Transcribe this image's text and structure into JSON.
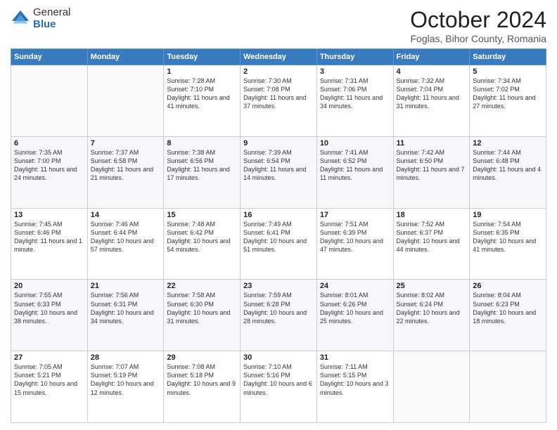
{
  "logo": {
    "general": "General",
    "blue": "Blue"
  },
  "header": {
    "month": "October 2024",
    "location": "Foglas, Bihor County, Romania"
  },
  "weekdays": [
    "Sunday",
    "Monday",
    "Tuesday",
    "Wednesday",
    "Thursday",
    "Friday",
    "Saturday"
  ],
  "weeks": [
    [
      {
        "day": "",
        "sunrise": "",
        "sunset": "",
        "daylight": ""
      },
      {
        "day": "",
        "sunrise": "",
        "sunset": "",
        "daylight": ""
      },
      {
        "day": "1",
        "sunrise": "Sunrise: 7:28 AM",
        "sunset": "Sunset: 7:10 PM",
        "daylight": "Daylight: 11 hours and 41 minutes."
      },
      {
        "day": "2",
        "sunrise": "Sunrise: 7:30 AM",
        "sunset": "Sunset: 7:08 PM",
        "daylight": "Daylight: 11 hours and 37 minutes."
      },
      {
        "day": "3",
        "sunrise": "Sunrise: 7:31 AM",
        "sunset": "Sunset: 7:06 PM",
        "daylight": "Daylight: 11 hours and 34 minutes."
      },
      {
        "day": "4",
        "sunrise": "Sunrise: 7:32 AM",
        "sunset": "Sunset: 7:04 PM",
        "daylight": "Daylight: 11 hours and 31 minutes."
      },
      {
        "day": "5",
        "sunrise": "Sunrise: 7:34 AM",
        "sunset": "Sunset: 7:02 PM",
        "daylight": "Daylight: 11 hours and 27 minutes."
      }
    ],
    [
      {
        "day": "6",
        "sunrise": "Sunrise: 7:35 AM",
        "sunset": "Sunset: 7:00 PM",
        "daylight": "Daylight: 11 hours and 24 minutes."
      },
      {
        "day": "7",
        "sunrise": "Sunrise: 7:37 AM",
        "sunset": "Sunset: 6:58 PM",
        "daylight": "Daylight: 11 hours and 21 minutes."
      },
      {
        "day": "8",
        "sunrise": "Sunrise: 7:38 AM",
        "sunset": "Sunset: 6:56 PM",
        "daylight": "Daylight: 11 hours and 17 minutes."
      },
      {
        "day": "9",
        "sunrise": "Sunrise: 7:39 AM",
        "sunset": "Sunset: 6:54 PM",
        "daylight": "Daylight: 11 hours and 14 minutes."
      },
      {
        "day": "10",
        "sunrise": "Sunrise: 7:41 AM",
        "sunset": "Sunset: 6:52 PM",
        "daylight": "Daylight: 11 hours and 11 minutes."
      },
      {
        "day": "11",
        "sunrise": "Sunrise: 7:42 AM",
        "sunset": "Sunset: 6:50 PM",
        "daylight": "Daylight: 11 hours and 7 minutes."
      },
      {
        "day": "12",
        "sunrise": "Sunrise: 7:44 AM",
        "sunset": "Sunset: 6:48 PM",
        "daylight": "Daylight: 11 hours and 4 minutes."
      }
    ],
    [
      {
        "day": "13",
        "sunrise": "Sunrise: 7:45 AM",
        "sunset": "Sunset: 6:46 PM",
        "daylight": "Daylight: 11 hours and 1 minute."
      },
      {
        "day": "14",
        "sunrise": "Sunrise: 7:46 AM",
        "sunset": "Sunset: 6:44 PM",
        "daylight": "Daylight: 10 hours and 57 minutes."
      },
      {
        "day": "15",
        "sunrise": "Sunrise: 7:48 AM",
        "sunset": "Sunset: 6:42 PM",
        "daylight": "Daylight: 10 hours and 54 minutes."
      },
      {
        "day": "16",
        "sunrise": "Sunrise: 7:49 AM",
        "sunset": "Sunset: 6:41 PM",
        "daylight": "Daylight: 10 hours and 51 minutes."
      },
      {
        "day": "17",
        "sunrise": "Sunrise: 7:51 AM",
        "sunset": "Sunset: 6:39 PM",
        "daylight": "Daylight: 10 hours and 47 minutes."
      },
      {
        "day": "18",
        "sunrise": "Sunrise: 7:52 AM",
        "sunset": "Sunset: 6:37 PM",
        "daylight": "Daylight: 10 hours and 44 minutes."
      },
      {
        "day": "19",
        "sunrise": "Sunrise: 7:54 AM",
        "sunset": "Sunset: 6:35 PM",
        "daylight": "Daylight: 10 hours and 41 minutes."
      }
    ],
    [
      {
        "day": "20",
        "sunrise": "Sunrise: 7:55 AM",
        "sunset": "Sunset: 6:33 PM",
        "daylight": "Daylight: 10 hours and 38 minutes."
      },
      {
        "day": "21",
        "sunrise": "Sunrise: 7:56 AM",
        "sunset": "Sunset: 6:31 PM",
        "daylight": "Daylight: 10 hours and 34 minutes."
      },
      {
        "day": "22",
        "sunrise": "Sunrise: 7:58 AM",
        "sunset": "Sunset: 6:30 PM",
        "daylight": "Daylight: 10 hours and 31 minutes."
      },
      {
        "day": "23",
        "sunrise": "Sunrise: 7:59 AM",
        "sunset": "Sunset: 6:28 PM",
        "daylight": "Daylight: 10 hours and 28 minutes."
      },
      {
        "day": "24",
        "sunrise": "Sunrise: 8:01 AM",
        "sunset": "Sunset: 6:26 PM",
        "daylight": "Daylight: 10 hours and 25 minutes."
      },
      {
        "day": "25",
        "sunrise": "Sunrise: 8:02 AM",
        "sunset": "Sunset: 6:24 PM",
        "daylight": "Daylight: 10 hours and 22 minutes."
      },
      {
        "day": "26",
        "sunrise": "Sunrise: 8:04 AM",
        "sunset": "Sunset: 6:23 PM",
        "daylight": "Daylight: 10 hours and 18 minutes."
      }
    ],
    [
      {
        "day": "27",
        "sunrise": "Sunrise: 7:05 AM",
        "sunset": "Sunset: 5:21 PM",
        "daylight": "Daylight: 10 hours and 15 minutes."
      },
      {
        "day": "28",
        "sunrise": "Sunrise: 7:07 AM",
        "sunset": "Sunset: 5:19 PM",
        "daylight": "Daylight: 10 hours and 12 minutes."
      },
      {
        "day": "29",
        "sunrise": "Sunrise: 7:08 AM",
        "sunset": "Sunset: 5:18 PM",
        "daylight": "Daylight: 10 hours and 9 minutes."
      },
      {
        "day": "30",
        "sunrise": "Sunrise: 7:10 AM",
        "sunset": "Sunset: 5:16 PM",
        "daylight": "Daylight: 10 hours and 6 minutes."
      },
      {
        "day": "31",
        "sunrise": "Sunrise: 7:11 AM",
        "sunset": "Sunset: 5:15 PM",
        "daylight": "Daylight: 10 hours and 3 minutes."
      },
      {
        "day": "",
        "sunrise": "",
        "sunset": "",
        "daylight": ""
      },
      {
        "day": "",
        "sunrise": "",
        "sunset": "",
        "daylight": ""
      }
    ]
  ]
}
